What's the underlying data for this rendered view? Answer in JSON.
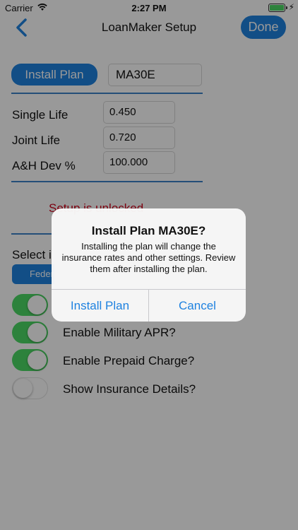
{
  "status_bar": {
    "carrier": "Carrier",
    "time": "2:27 PM"
  },
  "nav": {
    "title": "LoanMaker Setup",
    "done_label": "Done"
  },
  "plan": {
    "install_label": "Install Plan",
    "plan_code": "MA30E"
  },
  "rates": [
    {
      "label": "Single Life",
      "value": "0.450"
    },
    {
      "label": "Joint Life",
      "value": "0.720"
    },
    {
      "label": "A&H Dev %",
      "value": "100.000"
    }
  ],
  "unlock_text": "Setup is unlocked",
  "select_label": "Select i",
  "segment_label": "Feder",
  "toggles": [
    {
      "label": "",
      "on": true
    },
    {
      "label": "Enable Military APR?",
      "on": true
    },
    {
      "label": "Enable Prepaid Charge?",
      "on": true
    },
    {
      "label": "Show Insurance Details?",
      "on": false
    }
  ],
  "alert": {
    "title": "Install Plan MA30E?",
    "message": "Installing the plan will change the insurance rates and other settings. Review them after installing the plan.",
    "confirm_label": "Install Plan",
    "cancel_label": "Cancel"
  },
  "colors": {
    "accent": "#1f82e0",
    "rule": "#3d82c9",
    "toggle_on": "#4cd964",
    "warning": "#d0021b"
  }
}
